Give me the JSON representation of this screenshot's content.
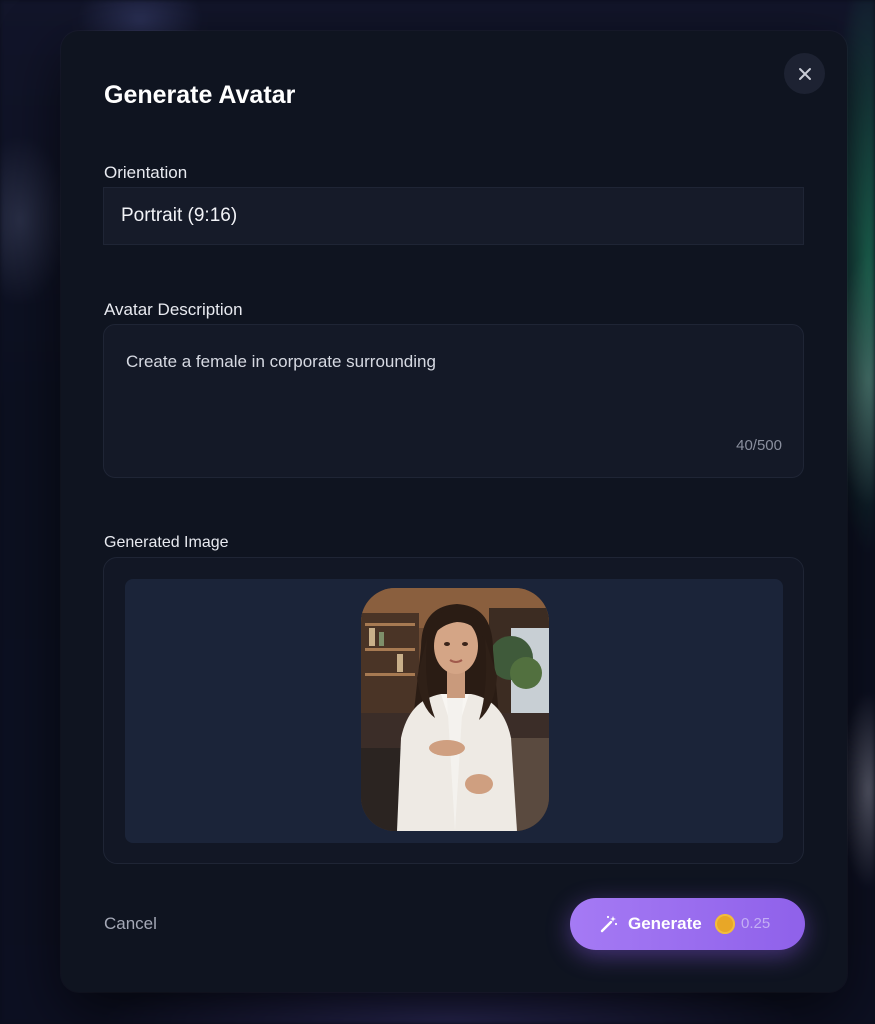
{
  "modal": {
    "title": "Generate Avatar",
    "close_icon": "close-icon"
  },
  "orientation": {
    "label": "Orientation",
    "selected": "Portrait (9:16)"
  },
  "description": {
    "label": "Avatar Description",
    "value": "Create a female in corporate surrounding",
    "counter": "40/500"
  },
  "generated": {
    "label": "Generated Image",
    "image_icon": "avatar-photo"
  },
  "footer": {
    "cancel_label": "Cancel",
    "generate_label": "Generate",
    "generate_icon": "magic-wand-icon",
    "coin_icon": "coin-icon",
    "cost": "0.25"
  },
  "colors": {
    "accent": "#9b6ff0",
    "coin": "#e8a727",
    "modal_bg": "#0f1420"
  }
}
